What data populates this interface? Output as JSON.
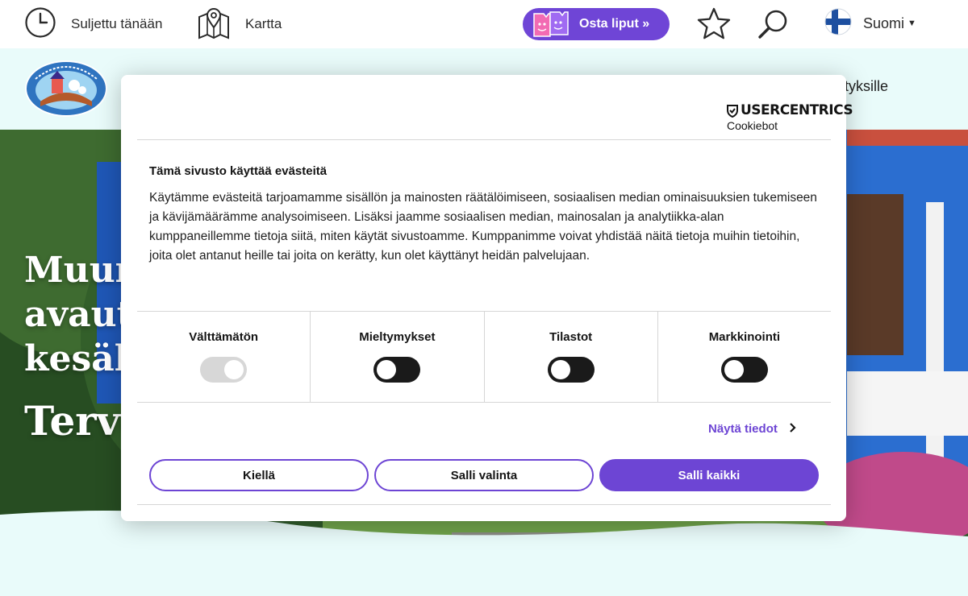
{
  "topbar": {
    "hours_status": "Suljettu tänään",
    "map_label": "Kartta",
    "tickets_label": "Osta liput »",
    "language": "Suomi"
  },
  "header": {
    "logo_alt": "Muumimaailma Naantali",
    "nav_peek": "ityksille"
  },
  "hero": {
    "title_lines": [
      "Muum",
      "avaut",
      "kesäl"
    ],
    "subtitle": "Terve"
  },
  "consent": {
    "brand_name": "USERCENTRICS",
    "brand_sub": "Cookiebot",
    "title": "Tämä sivusto käyttää evästeitä",
    "body": "Käytämme evästeitä tarjoamamme sisällön ja mainosten räätälöimiseen, sosiaalisen median ominaisuuksien tukemiseen ja kävijämäärämme analysoimiseen. Lisäksi jaamme sosiaalisen median, mainosalan ja analytiikka-alan kumppaneillemme tietoja siitä, miten käytät sivustoamme. Kumppanimme voivat yhdistää näitä tietoja muihin tietoihin, joita olet antanut heille tai joita on kerätty, kun olet käyttänyt heidän palvelujaan.",
    "categories": [
      {
        "label": "Välttämätön",
        "state": "on",
        "locked": true
      },
      {
        "label": "Mieltymykset",
        "state": "off",
        "locked": false
      },
      {
        "label": "Tilastot",
        "state": "off",
        "locked": false
      },
      {
        "label": "Markkinointi",
        "state": "off",
        "locked": false
      }
    ],
    "details_label": "Näytä tiedot",
    "deny_label": "Kiellä",
    "allow_selection_label": "Salli valinta",
    "allow_all_label": "Salli kaikki"
  },
  "colors": {
    "accent": "#6d45d4",
    "band": "#e9fbfa"
  },
  "icons": [
    "clock-icon",
    "map-pin-icon",
    "tickets-icon",
    "star-icon",
    "search-icon",
    "finland-flag-icon",
    "shield-icon",
    "chevron-right-icon"
  ]
}
